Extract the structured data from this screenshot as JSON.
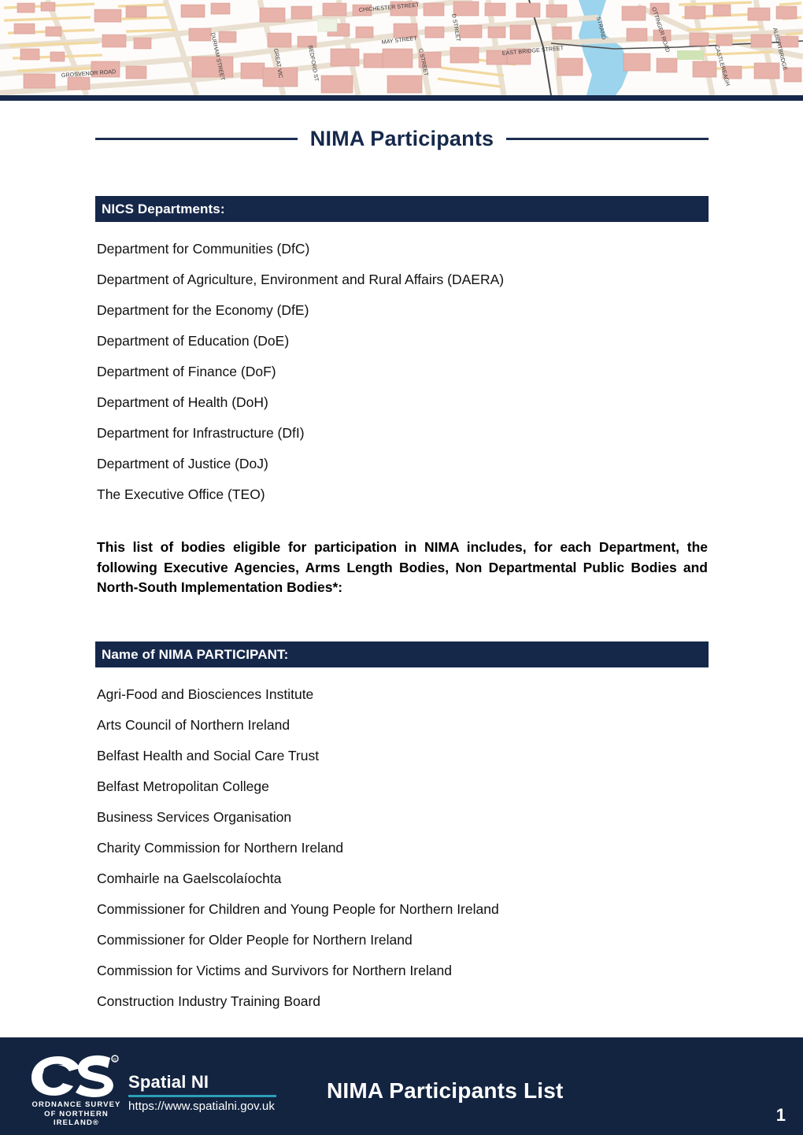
{
  "header": {
    "banner_image_name": "belfast-street-map-banner",
    "street_labels": [
      "CHICHESTER STREET",
      "MAY STREET",
      "EAST BRIDGE STREET",
      "GROSVENOR ROAD",
      "DURHAM STREET",
      "BEDFORD STREET",
      "GREAT VICTORIA STREET",
      "D STREET",
      "C STREET",
      "OTTINGER ROAD",
      "ALBERTBRIDGE",
      "CASTLEREAGH",
      "STRAND"
    ]
  },
  "title": "NIMA Participants",
  "departments_section": {
    "heading": "NICS Departments:",
    "items": [
      "Department for Communities (DfC)",
      "Department of Agriculture, Environment and Rural Affairs (DAERA)",
      "Department for the Economy (DfE)",
      "Department of Education (DoE)",
      "Department of Finance (DoF)",
      "Department of Health (DoH)",
      "Department for Infrastructure (DfI)",
      "Department of Justice (DoJ)",
      "The Executive Office (TEO)"
    ]
  },
  "intro_paragraph": "This list of bodies eligible for participation in NIMA includes, for each Department, the following Executive Agencies, Arms Length Bodies, Non Departmental Public Bodies and North-South Implementation Bodies*:",
  "participants_section": {
    "heading": "Name of NIMA PARTICIPANT:",
    "items": [
      "Agri-Food and Biosciences Institute",
      "Arts Council of Northern Ireland",
      "Belfast Health and Social Care Trust",
      "Belfast Metropolitan College",
      "Business Services Organisation",
      "Charity Commission for Northern Ireland",
      "Comhairle na Gaelscolaíochta",
      "Commissioner for Children and Young People for Northern Ireland",
      "Commissioner for Older People for Northern Ireland",
      "Commission for Victims and Survivors for Northern Ireland",
      "Construction Industry Training Board"
    ]
  },
  "footer": {
    "logo_line_1": "ORDNANCE  SURVEY",
    "logo_line_2": "OF NORTHERN IRELAND®",
    "spatial_name": "Spatial NI",
    "spatial_url": "https://www.spatialni.gov.uk",
    "document_title": "NIMA Participants List",
    "page_number": "1"
  },
  "colors": {
    "navy": "#16284a",
    "footer_navy": "#132440",
    "title_navy": "#16294c",
    "teal_accent": "#2a9fb6",
    "white": "#ffffff",
    "map_building": "#e7b3ab",
    "map_road": "#f2d9a0",
    "map_water": "#9bd4ec"
  }
}
